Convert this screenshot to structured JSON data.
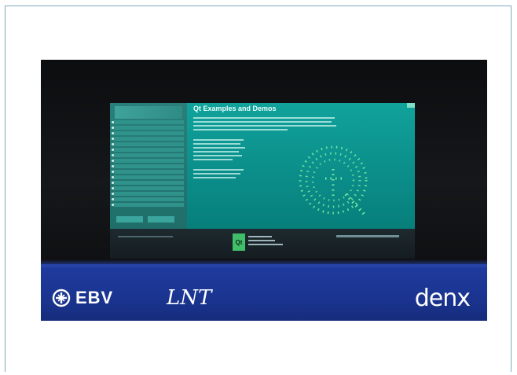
{
  "screen": {
    "title": "Qt Examples and Demos",
    "qt_logo": "Qt"
  },
  "branding": {
    "ebv": "EBV",
    "lnt": "LNT",
    "denx": "denx"
  },
  "colors": {
    "border": "#7fa6bd",
    "blue_band": "#1f3b9e",
    "screen_teal": "#0b8e8a",
    "qt_green": "#3fbf6a"
  }
}
